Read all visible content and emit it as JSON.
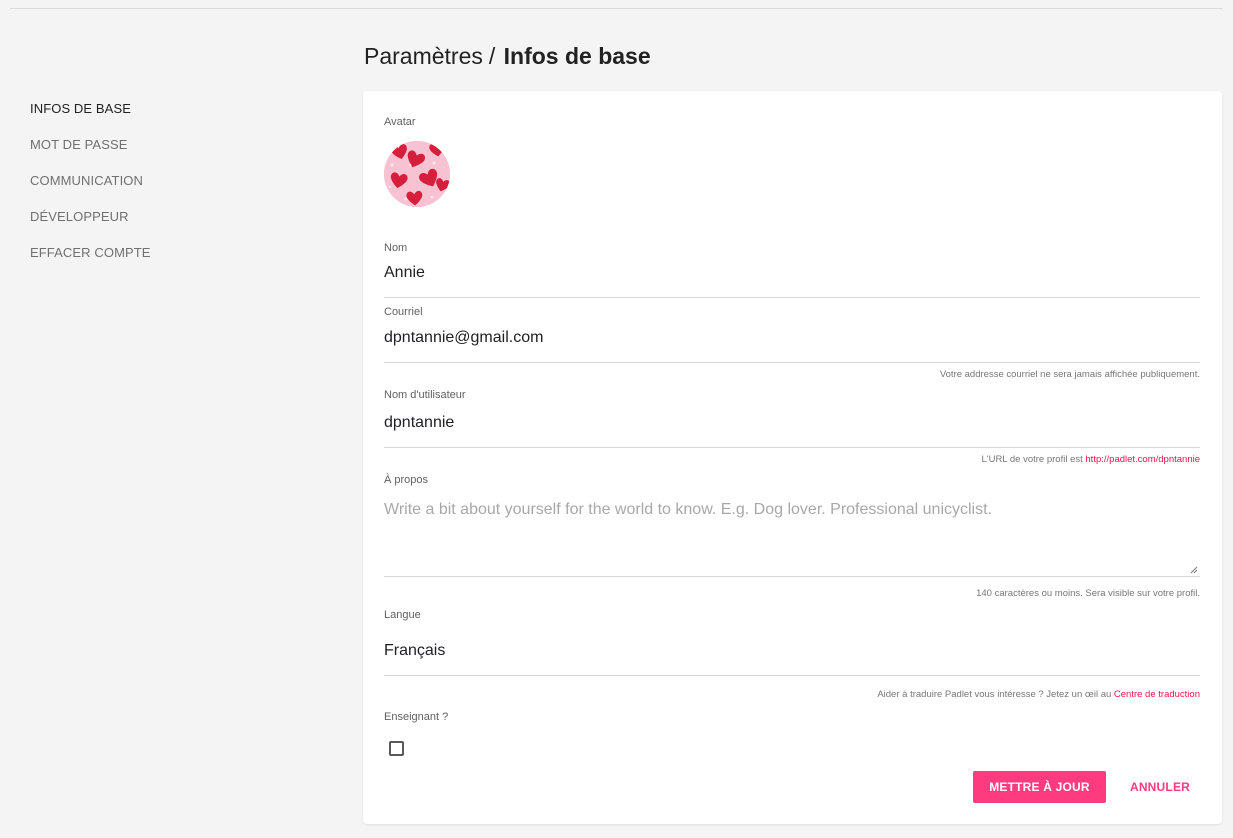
{
  "header": {
    "breadcrumb_parent": "Paramètres",
    "breadcrumb_separator": "/",
    "current_page": "Infos de base"
  },
  "sidebar": {
    "items": [
      {
        "label": "INFOS DE BASE",
        "active": true
      },
      {
        "label": "MOT DE PASSE",
        "active": false
      },
      {
        "label": "COMMUNICATION",
        "active": false
      },
      {
        "label": "DÉVELOPPEUR",
        "active": false
      },
      {
        "label": "EFFACER COMPTE",
        "active": false
      }
    ]
  },
  "form": {
    "avatar_label": "Avatar",
    "avatar_icon": "hearts-pattern-avatar",
    "name": {
      "label": "Nom",
      "value": "Annie"
    },
    "email": {
      "label": "Courriel",
      "value": "dpntannie@gmail.com",
      "helper": "Votre addresse courriel ne sera jamais affichée publiquement."
    },
    "username": {
      "label": "Nom d'utilisateur",
      "value": "dpntannie",
      "helper_prefix": "L'URL de votre profil est",
      "profile_url": "http://padlet.com/dpntannie"
    },
    "about": {
      "label": "À propos",
      "placeholder": "Write a bit about yourself for the world to know. E.g. Dog lover. Professional unicyclist.",
      "value": "",
      "helper": "140 caractères ou moins. Sera visible sur votre profil."
    },
    "language": {
      "label": "Langue",
      "value": "Français",
      "helper_prefix": "Aider à traduire Padlet vous intéresse ? Jetez un œil au",
      "helper_link": "Centre de traduction"
    },
    "teacher": {
      "label": "Enseignant ?",
      "checked": false
    }
  },
  "actions": {
    "update_label": "METTRE À JOUR",
    "cancel_label": "ANNULER"
  },
  "colors": {
    "accent": "#ff3b7f",
    "link": "#e8174e",
    "page_background": "#f4f4f4",
    "card_background": "#ffffff"
  }
}
